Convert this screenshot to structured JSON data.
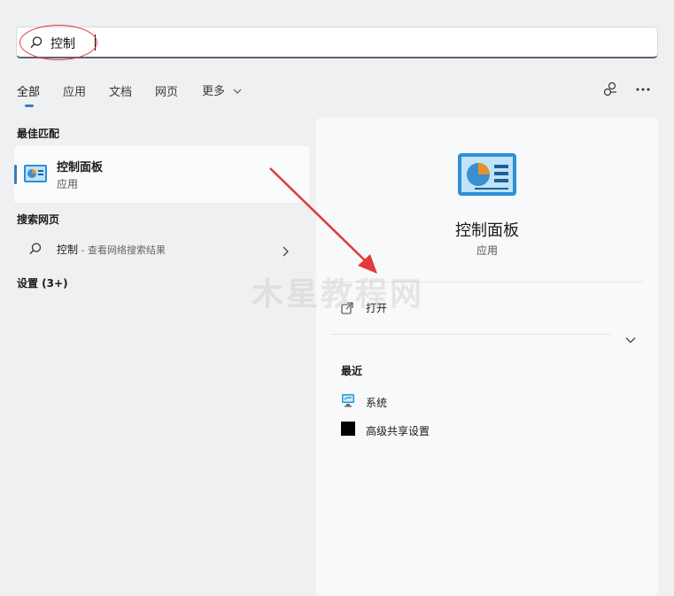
{
  "search": {
    "value": "控制"
  },
  "tabs": [
    "全部",
    "应用",
    "文档",
    "网页",
    "更多"
  ],
  "sections": {
    "best_match": "最佳匹配",
    "search_web": "搜索网页",
    "settings": "设置 (3+)"
  },
  "best_match": {
    "title": "控制面板",
    "subtitle": "应用"
  },
  "web_result": {
    "query": "控制",
    "suffix": " - 查看网络搜索结果"
  },
  "detail": {
    "title": "控制面板",
    "subtitle": "应用",
    "open_label": "打开",
    "recent_header": "最近",
    "recent_items": [
      "系统",
      "高级共享设置"
    ]
  },
  "watermark": "木星教程网",
  "colors": {
    "accent": "#3b7ab9",
    "annotation": "#e23b3b"
  }
}
